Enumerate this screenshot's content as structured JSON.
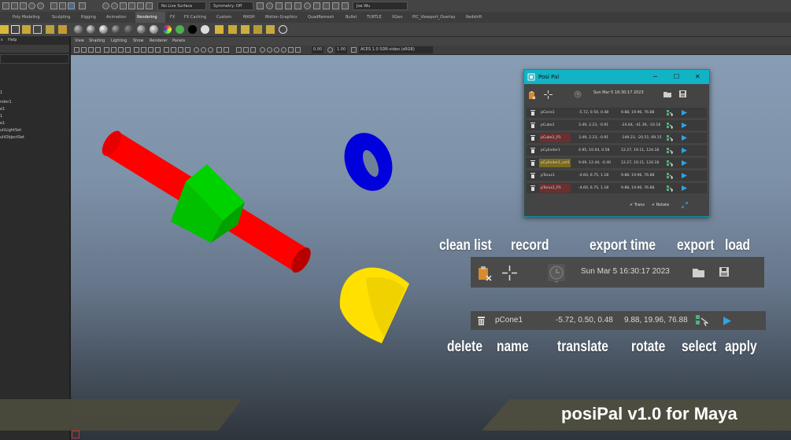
{
  "statusbar": {
    "live_surface": "No Live Surface",
    "symmetry": "Symmetry: Off",
    "user": "Joe Wu"
  },
  "shelf_tabs": [
    "Poly Modeling",
    "Sculpting",
    "Rigging",
    "Animation",
    "Rendering",
    "FX",
    "FX Caching",
    "Custom",
    "MASH",
    "Motion Graphics",
    "QuadRemesh",
    "Bullet",
    "TURTLE",
    "XGen",
    "PIC_Viewport_Overlay",
    "Redshift"
  ],
  "active_shelf_tab": "Rendering",
  "outliner": {
    "menu_help": "Help",
    "items": [
      "1",
      "nder1",
      "e1",
      "1",
      "e1",
      "ultLightSet",
      "ultObjectSet"
    ]
  },
  "viewport": {
    "menu": [
      "View",
      "Shading",
      "Lighting",
      "Show",
      "Renderer",
      "Panels"
    ],
    "field_a": "0.00",
    "field_b": "1.00",
    "color_space": "ACES 1.0 SDR-video (sRGB)"
  },
  "posipal": {
    "title": "Posi Pal",
    "timestamp": "Sun Mar  5 16:30:17 2023",
    "rows": [
      {
        "name": "pCone1",
        "translate": "-5.72, 0.50, 0.48",
        "rotate": "9.88, 19.96, 76.88",
        "highlight": ""
      },
      {
        "name": "pCube1",
        "translate": "3.49, 2.23, -0.91",
        "rotate": "-24.64, -41.39, -10.16",
        "highlight": ""
      },
      {
        "name": "pCube1_P1",
        "translate": "3.49, 2.23, -0.91",
        "rotate": "-149.23, -20.51, 69.15",
        "highlight": "#6b2f2f"
      },
      {
        "name": "pCylinder1",
        "translate": "4.95, 10.04, 0.58",
        "rotate": "12.27, 19.11, 124.18",
        "highlight": ""
      },
      {
        "name": "pCylinder1_set1",
        "translate": "9.09, 12.44, -0.40",
        "rotate": "12.27, 19.11, 124.18",
        "highlight": "#7a6a1e"
      },
      {
        "name": "pTorus1",
        "translate": "-4.60, 6.75, 1.18",
        "rotate": "9.88, 19.96, 76.88",
        "highlight": ""
      },
      {
        "name": "pTorus1_P1",
        "translate": "-4.60, 6.75, 1.18",
        "rotate": "9.88, 19.96, 76.88",
        "highlight": "#6b2f2f"
      }
    ],
    "trans_label": "Trans",
    "rotate_label": "Rotate"
  },
  "annotations": {
    "top_labels": [
      "clean list",
      "record",
      "export time",
      "export",
      "load"
    ],
    "bottom_labels": [
      "delete",
      "name",
      "translate",
      "rotate",
      "select",
      "apply"
    ],
    "zoom_timestamp": "Sun Mar  5 16:30:17 2023",
    "zoom_row": {
      "name": "pCone1",
      "translate": "-5.72, 0.50, 0.48",
      "rotate": "9.88, 19.96, 76.88"
    }
  },
  "banner": "posiPal v1.0 for Maya",
  "colors": {
    "accent": "#12b3c4",
    "apply": "#2ea3e6",
    "select": "#52b07a",
    "cylinder": "#ff0000",
    "cube": "#00cc00",
    "torus": "#0000dd",
    "cone": "#ffe000"
  }
}
